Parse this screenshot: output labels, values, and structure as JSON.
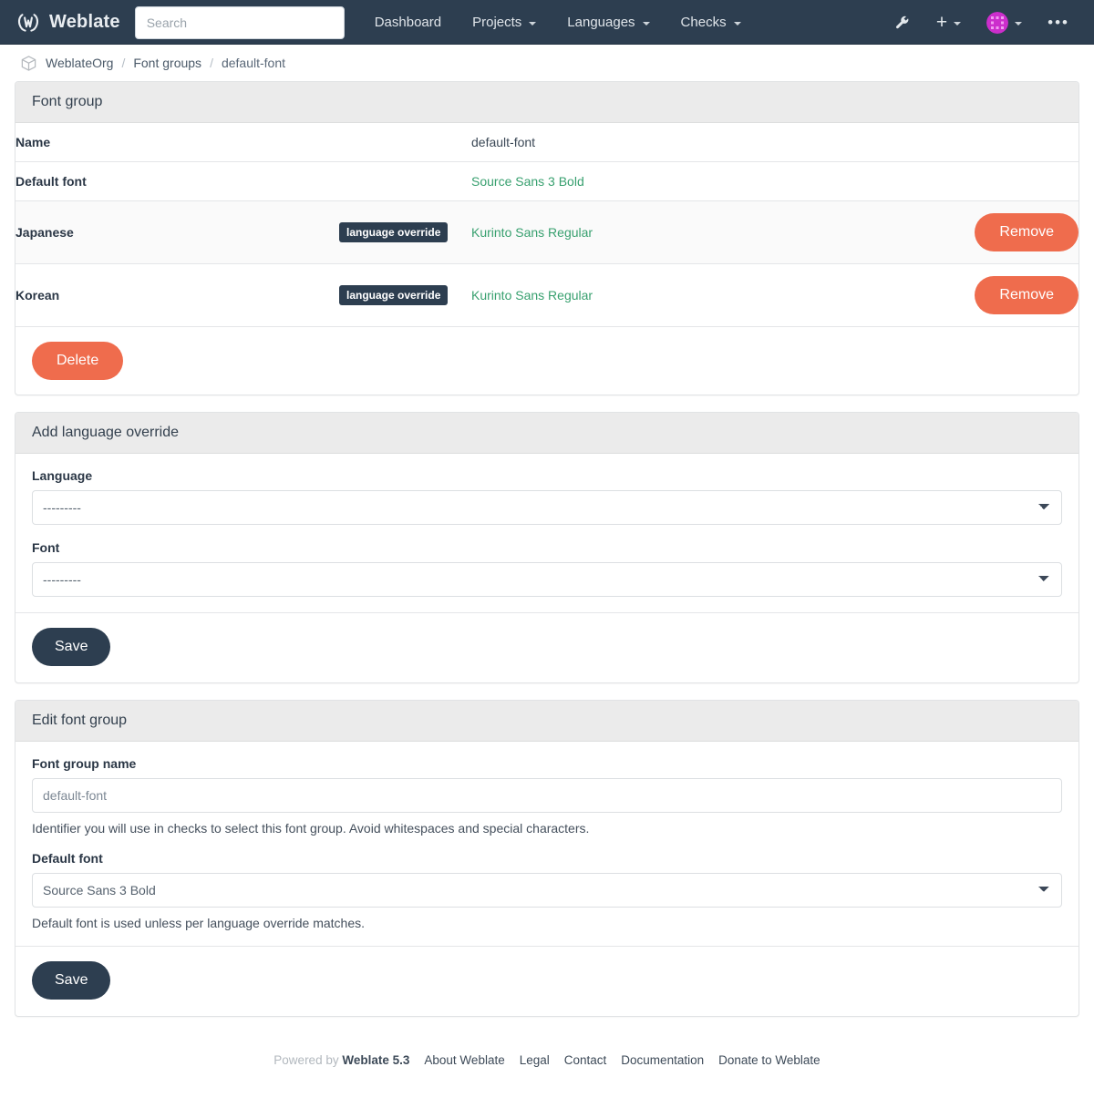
{
  "navbar": {
    "brand": "Weblate",
    "brand_icon": "weblate-logo-icon",
    "search_placeholder": "Search",
    "search_value": "",
    "links": [
      {
        "label": "Dashboard",
        "has_caret": false
      },
      {
        "label": "Projects",
        "has_caret": true
      },
      {
        "label": "Languages",
        "has_caret": true
      },
      {
        "label": "Checks",
        "has_caret": true
      }
    ],
    "tools_icon": "wrench-icon",
    "add_icon": "plus-icon",
    "avatar_icon": "user-avatar-icon",
    "more_icon": "ellipsis-icon"
  },
  "breadcrumb": {
    "icon": "cube-icon",
    "items": [
      {
        "label": "WeblateOrg",
        "current": false
      },
      {
        "label": "Font groups",
        "current": false
      },
      {
        "label": "default-font",
        "current": true
      }
    ],
    "separator": "/"
  },
  "font_group_panel": {
    "title": "Font group",
    "rows": [
      {
        "label": "Name",
        "badge": "",
        "value": "default-font",
        "value_is_link": false,
        "action": ""
      },
      {
        "label": "Default font",
        "badge": "",
        "value": "Source Sans 3 Bold",
        "value_is_link": true,
        "action": ""
      },
      {
        "label": "Japanese",
        "badge": "language override",
        "value": "Kurinto Sans Regular",
        "value_is_link": true,
        "action": "Remove"
      },
      {
        "label": "Korean",
        "badge": "language override",
        "value": "Kurinto Sans Regular",
        "value_is_link": true,
        "action": "Remove"
      }
    ],
    "delete_label": "Delete"
  },
  "add_override_panel": {
    "title": "Add language override",
    "language_label": "Language",
    "language_value": "---------",
    "font_label": "Font",
    "font_value": "---------",
    "save_label": "Save"
  },
  "edit_panel": {
    "title": "Edit font group",
    "name_label": "Font group name",
    "name_value": "default-font",
    "name_help": "Identifier you will use in checks to select this font group. Avoid whitespaces and special characters.",
    "default_font_label": "Default font",
    "default_font_value": "Source Sans 3 Bold",
    "default_font_help": "Default font is used unless per language override matches.",
    "save_label": "Save"
  },
  "footer": {
    "powered_prefix": "Powered by",
    "powered_name": "Weblate 5.3",
    "links": [
      "About Weblate",
      "Legal",
      "Contact",
      "Documentation",
      "Donate to Weblate"
    ]
  },
  "colors": {
    "navbar_bg": "#2d3e50",
    "accent_green": "#38a06f",
    "danger": "#ef6c4d",
    "dark": "#2d3e50",
    "panel_header": "#ebebeb"
  }
}
